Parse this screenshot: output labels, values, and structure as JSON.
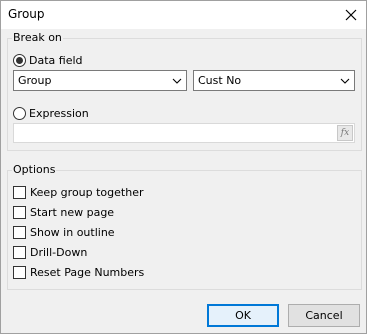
{
  "window": {
    "title": "Group"
  },
  "break_on": {
    "legend": "Break on",
    "data_field_label": "Data field",
    "data_field_checked": true,
    "group_select_value": "Group",
    "field_select_value": "Cust No",
    "expression_label": "Expression",
    "expression_checked": false,
    "expression_value": "",
    "fx_label": "fx"
  },
  "options": {
    "legend": "Options",
    "items": [
      {
        "label": "Keep group together",
        "checked": false
      },
      {
        "label": "Start new page",
        "checked": false
      },
      {
        "label": "Show in outline",
        "checked": false
      },
      {
        "label": "Drill-Down",
        "checked": false
      },
      {
        "label": "Reset Page Numbers",
        "checked": false
      }
    ]
  },
  "buttons": {
    "ok": "OK",
    "cancel": "Cancel"
  }
}
